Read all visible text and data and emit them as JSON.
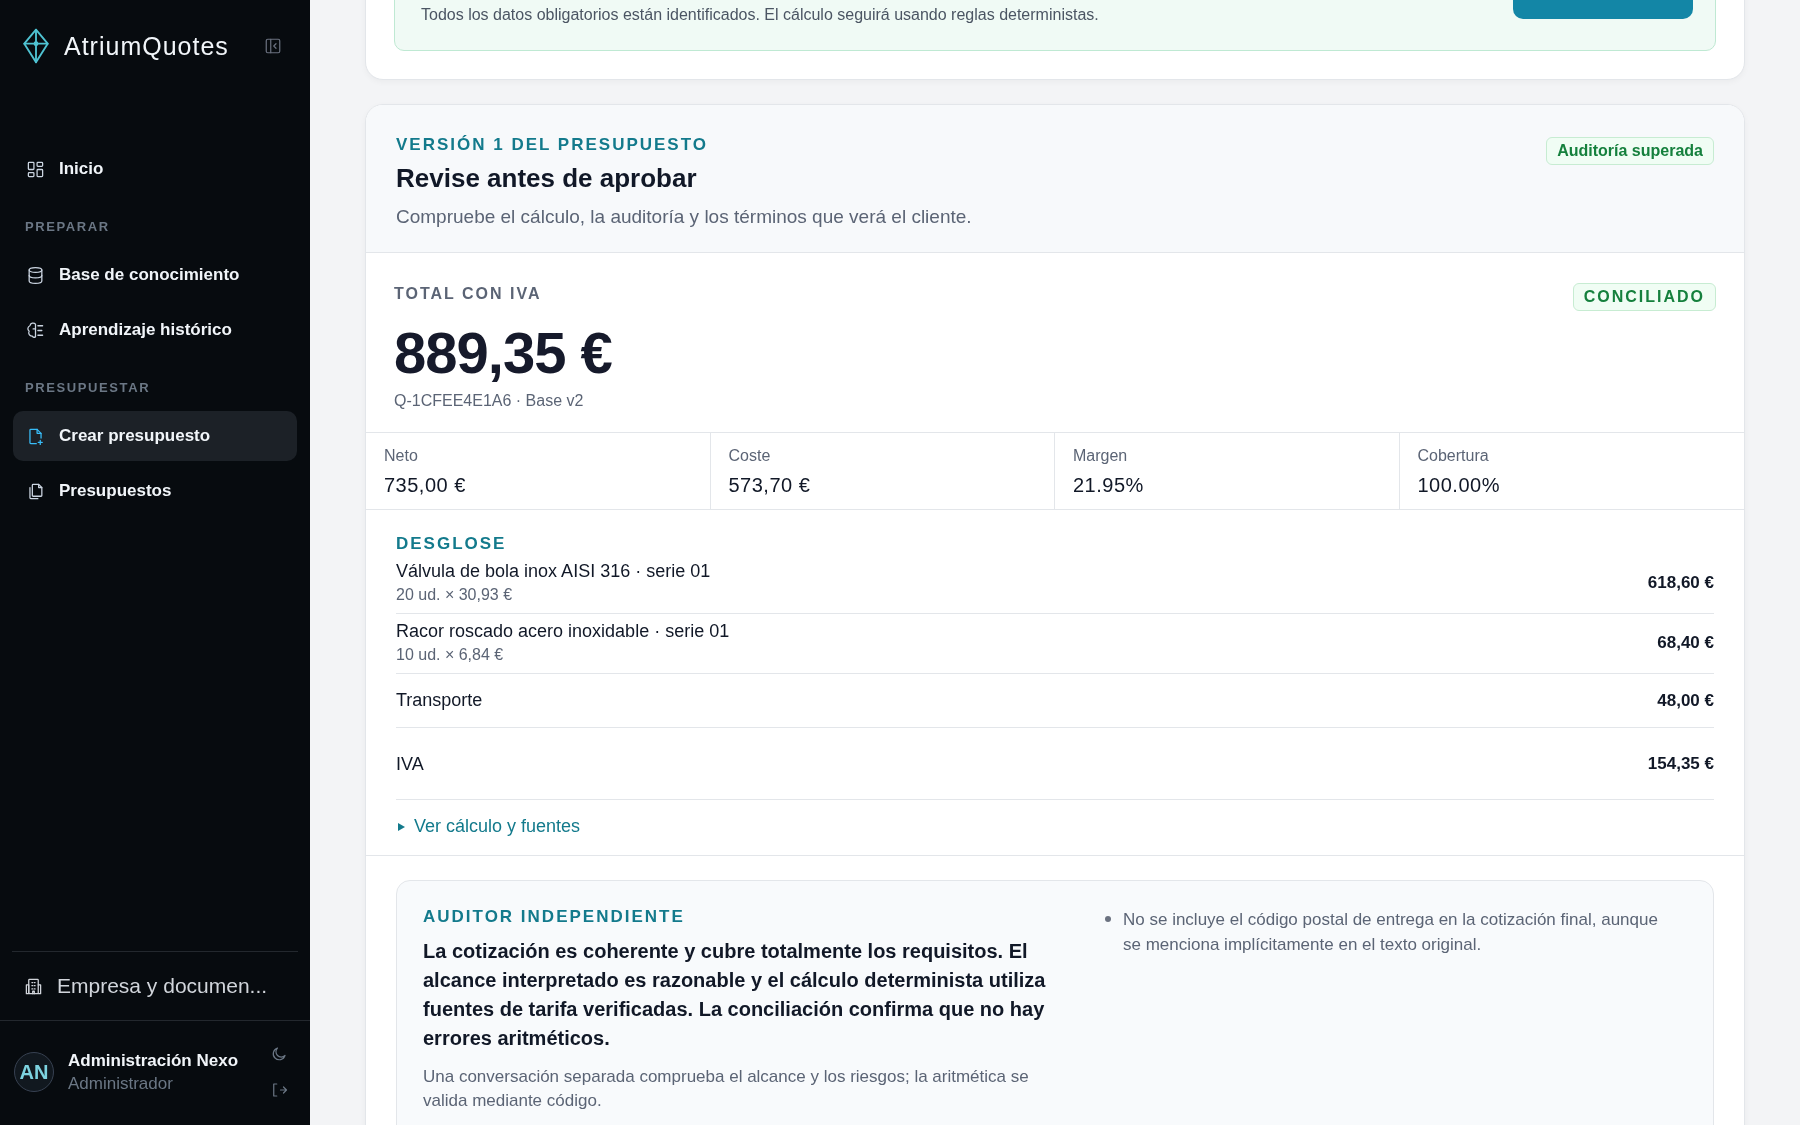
{
  "sidebar": {
    "brand": "AtriumQuotes",
    "nav": [
      {
        "kind": "item",
        "label": "Inicio",
        "selected": false
      },
      {
        "kind": "section",
        "label": "PREPARAR"
      },
      {
        "kind": "item",
        "label": "Base de conocimiento",
        "selected": false
      },
      {
        "kind": "item",
        "label": "Aprendizaje histórico",
        "selected": false
      },
      {
        "kind": "section",
        "label": "PRESUPUESTAR"
      },
      {
        "kind": "item",
        "label": "Crear presupuesto",
        "selected": true
      },
      {
        "kind": "item",
        "label": "Presupuestos",
        "selected": false
      }
    ],
    "footer_item": {
      "label": "Empresa y documen..."
    },
    "user": {
      "initials": "AN",
      "name": "Administración Nexo",
      "role": "Administrador"
    }
  },
  "requirements": {
    "notice": "Todos los datos obligatorios están identificados. El cálculo seguirá usando reglas deterministas."
  },
  "quote": {
    "eyebrow": "VERSIÓN 1 DEL PRESUPUESTO",
    "title": "Revise antes de aprobar",
    "subtitle": "Compruebe el cálculo, la auditoría y los términos que verá el cliente.",
    "audit_badge": "Auditoría superada",
    "total_label": "TOTAL CON IVA",
    "status_badge": "CONCILIADO",
    "total": "889,35 €",
    "reference": "Q-1CFEE4E1A6 · Base v2",
    "metrics": [
      {
        "label": "Neto",
        "value": "735,00 €"
      },
      {
        "label": "Coste",
        "value": "573,70 €"
      },
      {
        "label": "Margen",
        "value": "21.95%"
      },
      {
        "label": "Cobertura",
        "value": "100.00%"
      }
    ],
    "breakdown": {
      "heading": "DESGLOSE",
      "lines": [
        {
          "description": "Válvula de bola inox AISI 316 · serie 01",
          "detail": "20 ud. × 30,93 €",
          "amount": "618,60 €"
        },
        {
          "description": "Racor roscado acero inoxidable · serie 01",
          "detail": "10 ud. × 6,84 €",
          "amount": "68,40 €"
        },
        {
          "description": "Transporte",
          "amount": "48,00 €"
        },
        {
          "description": "IVA",
          "amount": "154,35 €"
        }
      ]
    },
    "details_link": {
      "label": "Ver cálculo y fuentes",
      "expanded": false
    },
    "auditor": {
      "heading": "AUDITOR INDEPENDIENTE",
      "summary": "La cotización es coherente y cubre totalmente los requisitos. El alcance interpretado es razonable y el cálculo determinista utiliza fuentes de tarifa verificadas. La conciliación confirma que no hay errores aritméticos.",
      "note": "Una conversación separada comprueba el alcance y los riesgos; la aritmética se valida mediante código.",
      "findings": [
        "No se incluye el código postal de entrega en la cotización final, aunque se menciona implícitamente en el texto original."
      ]
    }
  }
}
